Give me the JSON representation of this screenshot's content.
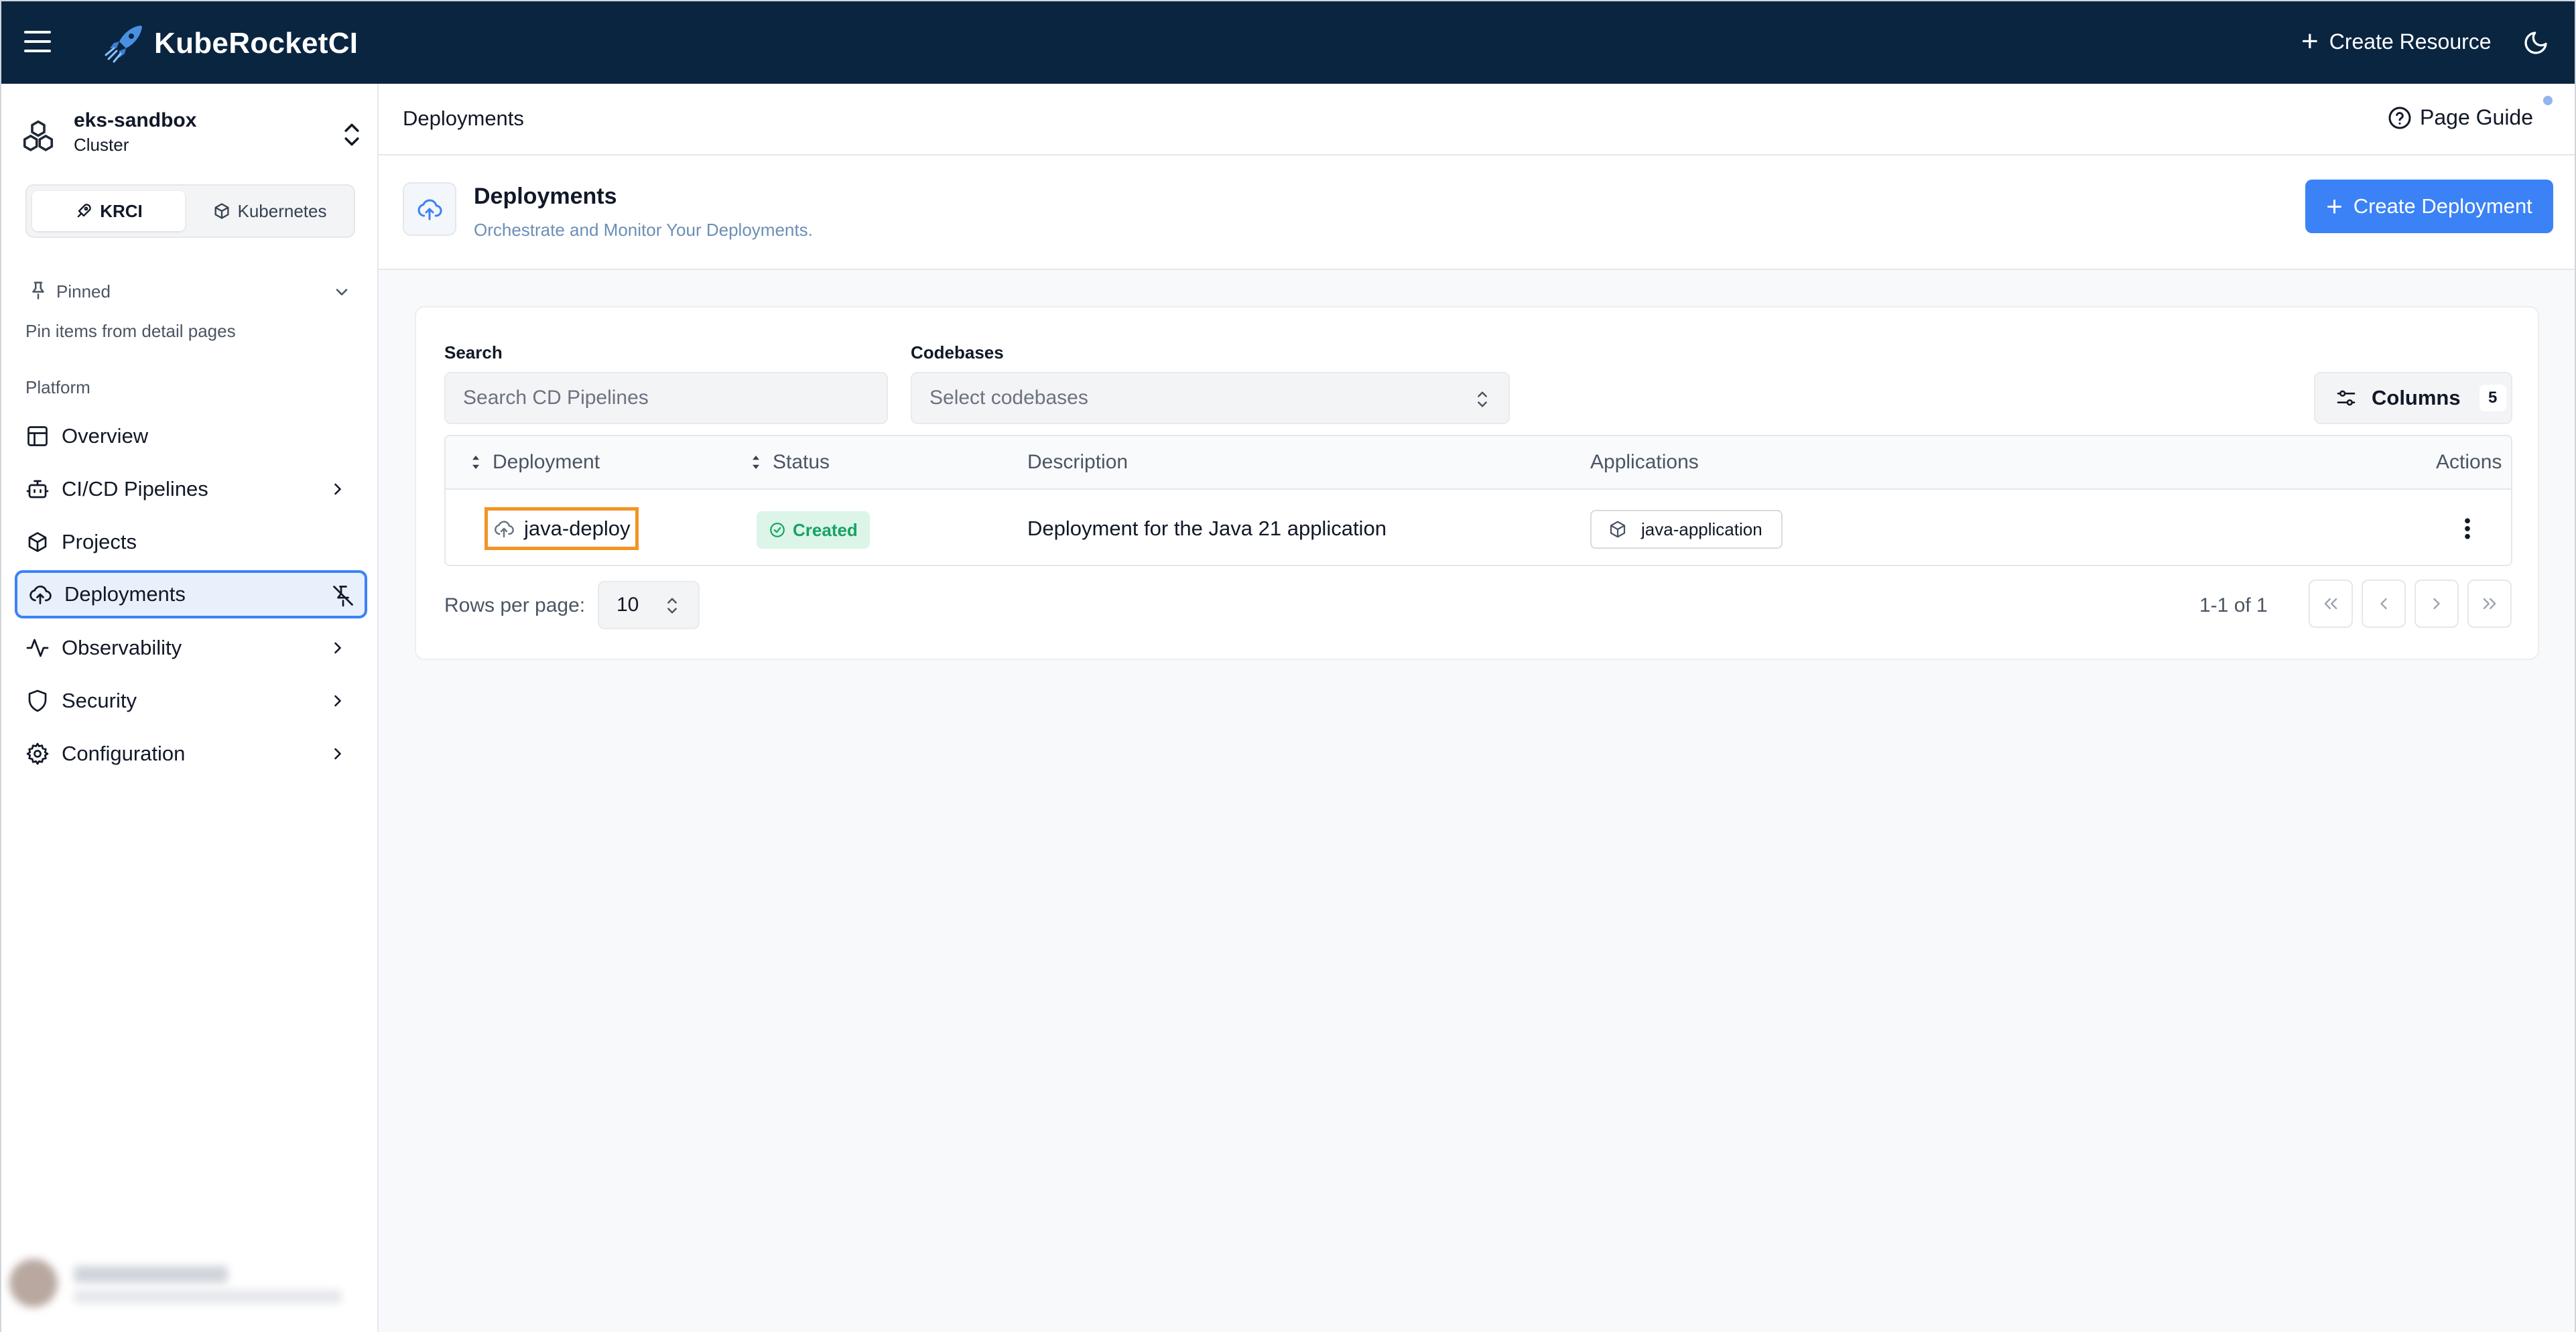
{
  "app": {
    "title": "KubeRocketCI",
    "create_resource_label": "Create Resource",
    "brand_color": "#0a2540",
    "accent_color": "#3b82f6"
  },
  "sidebar": {
    "cluster": {
      "name": "eks-sandbox",
      "type": "Cluster"
    },
    "mode_tabs": [
      {
        "label": "KRCI",
        "icon": "rocket-icon",
        "selected": true
      },
      {
        "label": "Kubernetes",
        "icon": "cube-icon",
        "selected": false
      }
    ],
    "pinned": {
      "label": "Pinned",
      "hint": "Pin items from detail pages"
    },
    "section_label": "Platform",
    "items": [
      {
        "label": "Overview",
        "icon": "layout-icon",
        "has_submenu": false
      },
      {
        "label": "CI/CD Pipelines",
        "icon": "bot-icon",
        "has_submenu": true
      },
      {
        "label": "Projects",
        "icon": "box-icon",
        "has_submenu": false
      },
      {
        "label": "Deployments",
        "icon": "cloud-upload-icon",
        "has_submenu": false,
        "active": true
      },
      {
        "label": "Observability",
        "icon": "activity-icon",
        "has_submenu": true
      },
      {
        "label": "Security",
        "icon": "shield-icon",
        "has_submenu": true
      },
      {
        "label": "Configuration",
        "icon": "gear-icon",
        "has_submenu": true
      }
    ]
  },
  "main": {
    "breadcrumb": "Deployments",
    "page_guide_label": "Page Guide",
    "header": {
      "title": "Deployments",
      "subtitle": "Orchestrate and Monitor Your Deployments.",
      "create_button_label": "Create Deployment"
    },
    "filters": {
      "search_label": "Search",
      "search_placeholder": "Search CD Pipelines",
      "codebases_label": "Codebases",
      "codebases_placeholder": "Select codebases",
      "columns_label": "Columns",
      "columns_count": "5"
    },
    "table": {
      "columns": [
        "Deployment",
        "Status",
        "Description",
        "Applications",
        "Actions"
      ],
      "rows": [
        {
          "deployment": "java-deploy",
          "status": "Created",
          "description": "Deployment for the Java 21 application",
          "applications": [
            "java-application"
          ]
        }
      ]
    },
    "pagination": {
      "rows_per_page_label": "Rows per page:",
      "rows_per_page": "10",
      "range": "1-1 of 1"
    }
  }
}
